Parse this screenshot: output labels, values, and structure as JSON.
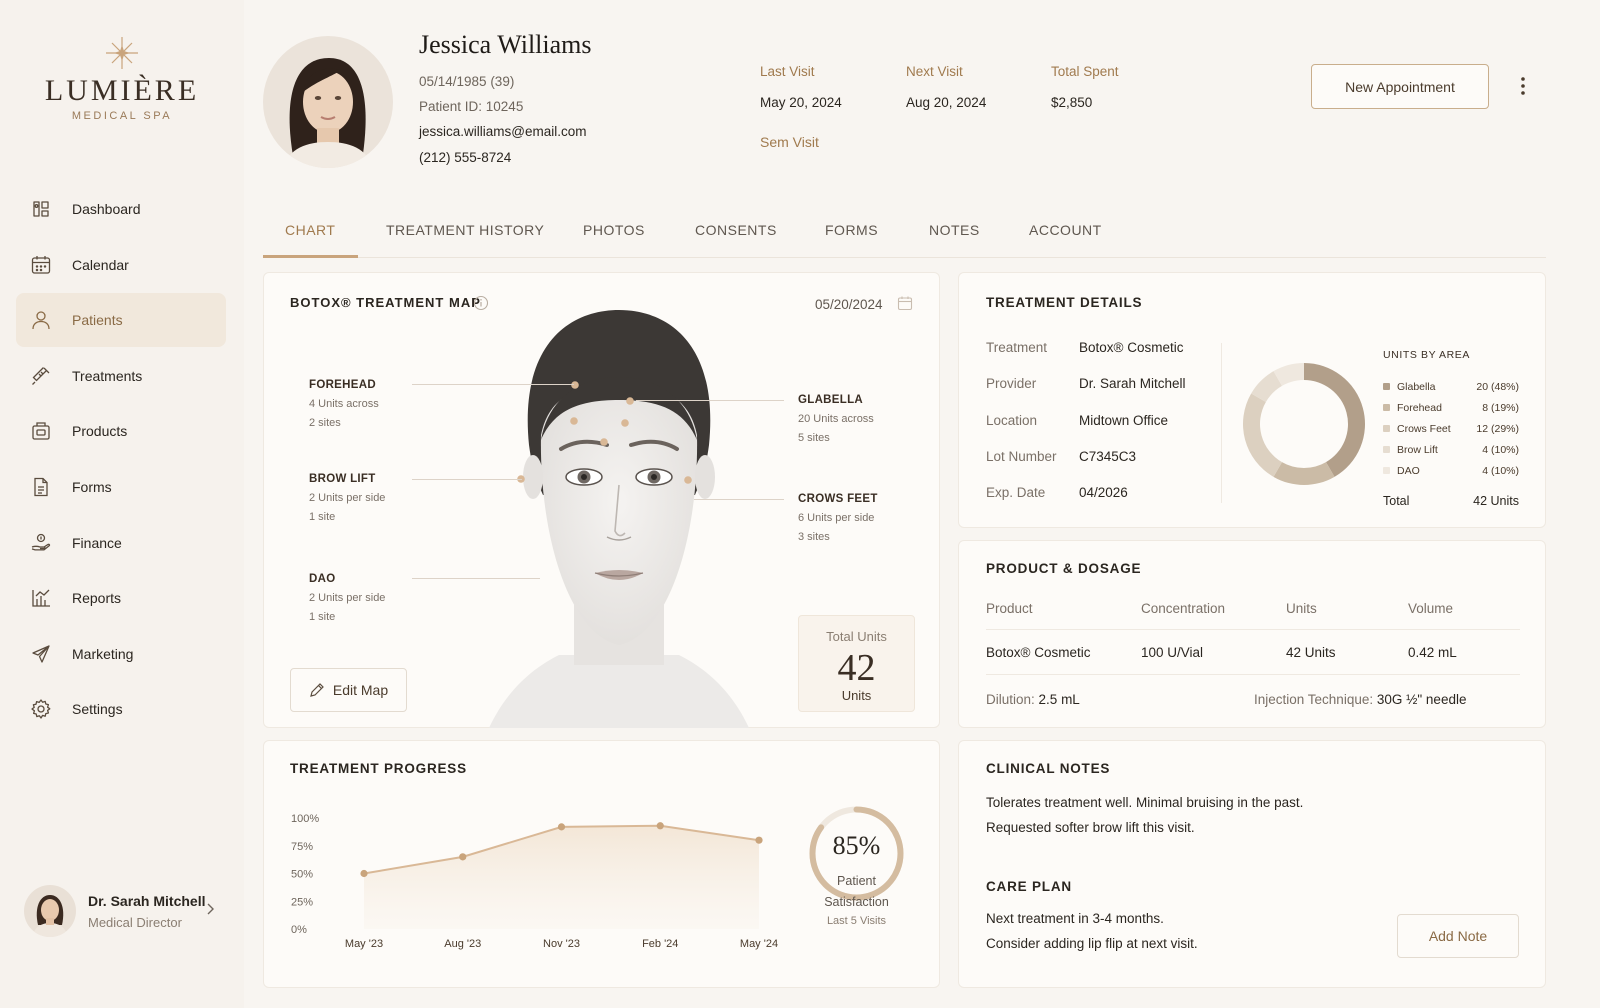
{
  "brand": {
    "name": "LUMIÈRE",
    "tagline": "MEDICAL SPA",
    "icon": "sparkle-logo-icon"
  },
  "sidebar": {
    "items": [
      {
        "label": "Dashboard",
        "icon": "dashboard-icon",
        "active": false
      },
      {
        "label": "Calendar",
        "icon": "calendar-icon",
        "active": false
      },
      {
        "label": "Patients",
        "icon": "user-icon",
        "active": true
      },
      {
        "label": "Treatments",
        "icon": "syringe-icon",
        "active": false
      },
      {
        "label": "Products",
        "icon": "box-icon",
        "active": false
      },
      {
        "label": "Forms",
        "icon": "document-icon",
        "active": false
      },
      {
        "label": "Finance",
        "icon": "money-icon",
        "active": false
      },
      {
        "label": "Reports",
        "icon": "chart-icon",
        "active": false
      },
      {
        "label": "Marketing",
        "icon": "megaphone-icon",
        "active": false
      },
      {
        "label": "Settings",
        "icon": "gear-icon",
        "active": false
      }
    ],
    "user": {
      "name": "Dr. Sarah Mitchell",
      "role": "Medical Director"
    }
  },
  "patient": {
    "name": "Jessica Williams",
    "dob": "05/14/1985 (39)",
    "id_text": "Patient ID: 10245",
    "email": "jessica.williams@email.com",
    "phone": "(212) 555-8724"
  },
  "stats": [
    {
      "label": "Last Visit",
      "value": "May 20, 2024"
    },
    {
      "label": "Next Visit",
      "value": "Aug 20, 2024"
    },
    {
      "label": "Total Spent",
      "value": "$2,850"
    }
  ],
  "visit_link": "Sem Visit",
  "header": {
    "new_appointment": "New Appointment"
  },
  "tabs": [
    "CHART",
    "TREATMENT HISTORY",
    "PHOTOS",
    "CONSENTS",
    "FORMS",
    "NOTES",
    "ACCOUNT"
  ],
  "treatment_map": {
    "title": "BOTOX® TREATMENT MAP",
    "date": "05/20/2024",
    "areas": [
      {
        "name": "FOREHEAD",
        "line1": "4 Units across",
        "line2": "2 sites"
      },
      {
        "name": "BROW LIFT",
        "line1": "2 Units per side",
        "line2": "1 site"
      },
      {
        "name": "DAO",
        "line1": "2 Units per side",
        "line2": "1 site"
      },
      {
        "name": "GLABELLA",
        "line1": "20 Units across",
        "line2": "5 sites"
      },
      {
        "name": "CROWS FEET",
        "line1": "6 Units per side",
        "line2": "3 sites"
      }
    ],
    "edit_button": "Edit Map",
    "total_label": "Total Units",
    "total_value": "42",
    "total_unit": "Units",
    "injection_point_color": "#d9b896"
  },
  "treatment_details": {
    "title": "TREATMENT DETAILS",
    "rows": [
      {
        "label": "Treatment",
        "value": "Botox® Cosmetic"
      },
      {
        "label": "Provider",
        "value": "Dr. Sarah Mitchell"
      },
      {
        "label": "Location",
        "value": "Midtown Office"
      },
      {
        "label": "Lot Number",
        "value": "C7345C3"
      },
      {
        "label": "Exp. Date",
        "value": "04/2026"
      }
    ],
    "units_by_area": {
      "title": "UNITS BY AREA",
      "items": [
        {
          "name": "Glabella",
          "value": "20 (48%)",
          "units": 20,
          "color": "#b29f8a"
        },
        {
          "name": "Forehead",
          "value": "8 (19%)",
          "units": 8,
          "color": "#cbbba6"
        },
        {
          "name": "Crows Feet",
          "value": "12 (29%)",
          "units": 12,
          "color": "#dcd0c0"
        },
        {
          "name": "Brow Lift",
          "value": "4 (10%)",
          "units": 4,
          "color": "#e6ddd1"
        },
        {
          "name": "DAO",
          "value": "4 (10%)",
          "units": 4,
          "color": "#efe8df"
        }
      ],
      "total_label": "Total",
      "total_value": "42 Units"
    }
  },
  "product_dosage": {
    "title": "PRODUCT & DOSAGE",
    "headers": [
      "Product",
      "Concentration",
      "Units",
      "Volume"
    ],
    "row": [
      "Botox® Cosmetic",
      "100 U/Vial",
      "42 Units",
      "0.42 mL"
    ],
    "dilution_label": "Dilution:",
    "dilution_value": "2.5 mL",
    "technique_label": "Injection Technique:",
    "technique_value": "30G ½\" needle"
  },
  "treatment_progress": {
    "title": "TREATMENT PROGRESS",
    "satisfaction_value": "85%",
    "satisfaction_fraction": 0.85,
    "satisfaction_label1": "Patient",
    "satisfaction_label2": "Satisfaction",
    "satisfaction_label3": "Last 5 Visits"
  },
  "chart_data": {
    "type": "area",
    "title": "",
    "categories": [
      "May '23",
      "Aug '23",
      "Nov '23",
      "Feb '24",
      "May '24"
    ],
    "values": [
      50,
      65,
      92,
      93,
      80
    ],
    "y_ticks": [
      "0%",
      "25%",
      "50%",
      "75%",
      "100%"
    ],
    "ylim": [
      0,
      100
    ],
    "grid": false,
    "color": "#d9b896"
  },
  "clinical_notes": {
    "title": "CLINICAL NOTES",
    "lines": [
      "Tolerates treatment well. Minimal bruising in the past.",
      "Requested softer brow lift this visit."
    ],
    "care_plan_title": "CARE PLAN",
    "care_plan_lines": [
      "Next treatment in 3-4 months.",
      "Consider adding lip flip at next visit."
    ],
    "add_button": "Add Note"
  }
}
